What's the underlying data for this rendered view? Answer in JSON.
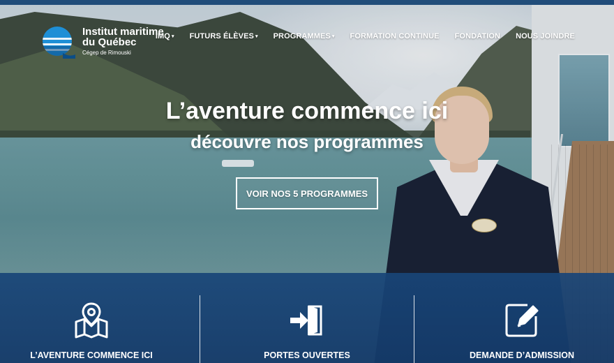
{
  "header": {
    "logo": {
      "line1": "Institut maritime",
      "line2": "du Québec",
      "line3": "Cégep de Rimouski"
    },
    "nav": [
      {
        "label": "IMQ",
        "dropdown": true
      },
      {
        "label": "FUTURS ÉLÈVES",
        "dropdown": true
      },
      {
        "label": "PROGRAMMES",
        "dropdown": true
      },
      {
        "label": "FORMATION CONTINUE",
        "dropdown": false
      },
      {
        "label": "FONDATION",
        "dropdown": false
      },
      {
        "label": "NOUS JOINDRE",
        "dropdown": false
      }
    ]
  },
  "hero": {
    "headline": "L’aventure commence ici",
    "subheadline": "découvre nos programmes",
    "cta_label": "VOIR NOS 5 PROGRAMMES"
  },
  "panel": {
    "items": [
      {
        "label": "L’AVENTURE COMMENCE ICI",
        "icon": "map-pin-icon"
      },
      {
        "label": "PORTES OUVERTES",
        "icon": "door-enter-icon"
      },
      {
        "label": "DEMANDE D’ADMISSION",
        "icon": "edit-form-icon"
      }
    ]
  },
  "colors": {
    "topbar": "#214d7a",
    "panel": "#184578",
    "logo_blue": "#1e8fd6",
    "text": "#ffffff"
  }
}
